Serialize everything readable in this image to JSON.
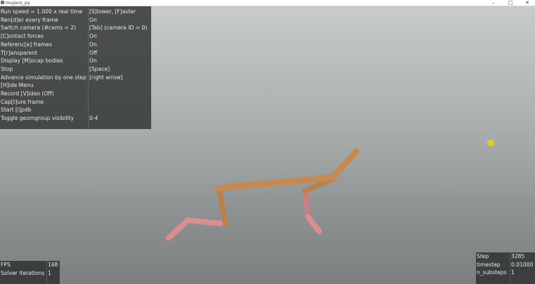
{
  "window": {
    "title": "mujoco_py"
  },
  "window_controls": {
    "minimize": "–",
    "maximize": "□",
    "close": "✕"
  },
  "menu": {
    "items": [
      {
        "label": "Run speed = 1.000 x real time",
        "value": "[S]lower, [F]aster"
      },
      {
        "label": "Ren[d]er every frame",
        "value": "On"
      },
      {
        "label": "Switch camera (#cams = 2)",
        "value": "[Tab] (camera ID = 0)"
      },
      {
        "label": "[C]ontact forces",
        "value": "On"
      },
      {
        "label": "Referenc[e] frames",
        "value": "On"
      },
      {
        "label": "T[r]ansparent",
        "value": "Off"
      },
      {
        "label": "Display [M]ocap bodies",
        "value": "On"
      },
      {
        "label": "Stop",
        "value": "[Space]"
      },
      {
        "label": "Advance simulation by one step",
        "value": "[right arrow]"
      },
      {
        "label": "[H]ide Menu",
        "value": ""
      },
      {
        "label": "Record [V]ideo (Off)",
        "value": ""
      },
      {
        "label": "Cap[t]ure frame",
        "value": ""
      },
      {
        "label": "Start [i]pdb",
        "value": ""
      },
      {
        "label": "Toggle geomgroup visibility",
        "value": "0-4"
      }
    ]
  },
  "stats": {
    "fps_label": "FPS",
    "fps_value": "168",
    "solver_label": "Solver iterations",
    "solver_value": "1"
  },
  "sim_info": {
    "step_label": "Step",
    "step_value": "3285",
    "timestep_label": "timestep",
    "timestep_value": "0.01000",
    "substeps_label": "n_substeps",
    "substeps_value": "1"
  },
  "colors": {
    "torso": "#c58a52",
    "thigh": "#b8824e",
    "foot_pink": "#d88f92",
    "target": "#d8d21e"
  }
}
